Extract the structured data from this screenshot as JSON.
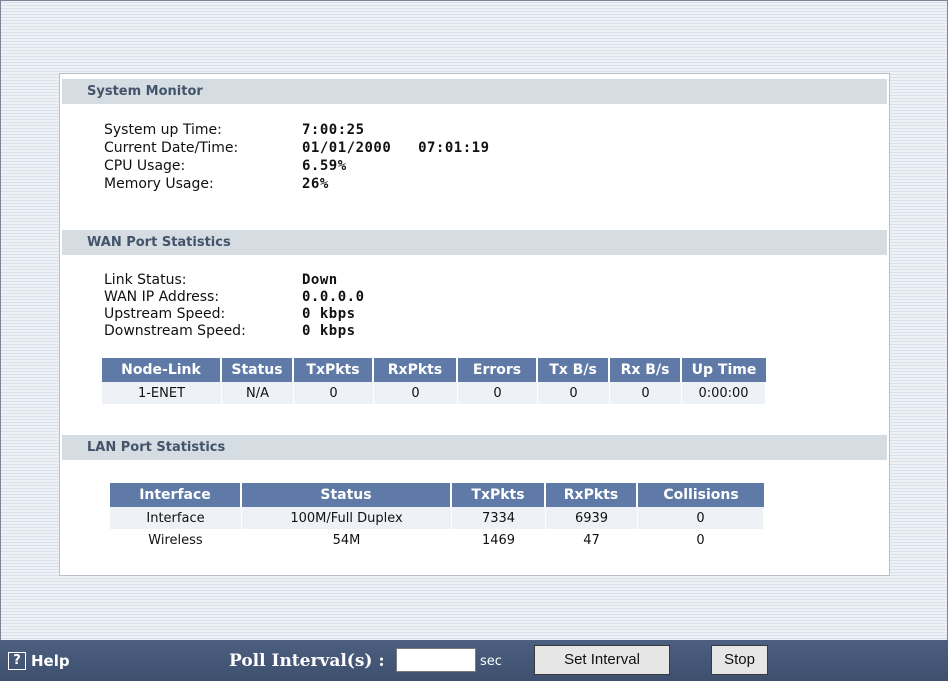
{
  "system_monitor": {
    "header": "System Monitor",
    "rows": [
      {
        "label": "System up Time:",
        "value": "7:00:25"
      },
      {
        "label": "Current Date/Time:",
        "value": "01/01/2000   07:01:19"
      },
      {
        "label": "CPU Usage:",
        "value": "6.59%"
      },
      {
        "label": "Memory Usage:",
        "value": "26%"
      }
    ]
  },
  "wan": {
    "header": "WAN Port Statistics",
    "rows": [
      {
        "label": "Link Status:",
        "value": "Down"
      },
      {
        "label": "WAN IP Address:",
        "value": "0.0.0.0"
      },
      {
        "label": "Upstream Speed:",
        "value": "0 kbps"
      },
      {
        "label": "Downstream Speed:",
        "value": "0 kbps"
      }
    ],
    "table": {
      "columns": [
        "Node-Link",
        "Status",
        "TxPkts",
        "RxPkts",
        "Errors",
        "Tx B/s",
        "Rx B/s",
        "Up Time"
      ],
      "rows": [
        [
          "1-ENET",
          "N/A",
          "0",
          "0",
          "0",
          "0",
          "0",
          "0:00:00"
        ]
      ]
    }
  },
  "lan": {
    "header": "LAN Port Statistics",
    "table": {
      "columns": [
        "Interface",
        "Status",
        "TxPkts",
        "RxPkts",
        "Collisions"
      ],
      "rows": [
        [
          "Interface",
          "100M/Full Duplex",
          "7334",
          "6939",
          "0"
        ],
        [
          "Wireless",
          "54M",
          "1469",
          "47",
          "0"
        ]
      ]
    }
  },
  "bottom": {
    "help_glyph": "?",
    "help_label": "Help",
    "poll_label": "Poll Interval(s) :",
    "poll_value": "",
    "sec_label": "sec",
    "set_interval_label": "Set Interval",
    "stop_label": "Stop"
  },
  "colors": {
    "header_bg": "#d5dde3",
    "table_header_bg": "#5f7aa7",
    "bottom_bar_bg": "#4c5f80"
  }
}
